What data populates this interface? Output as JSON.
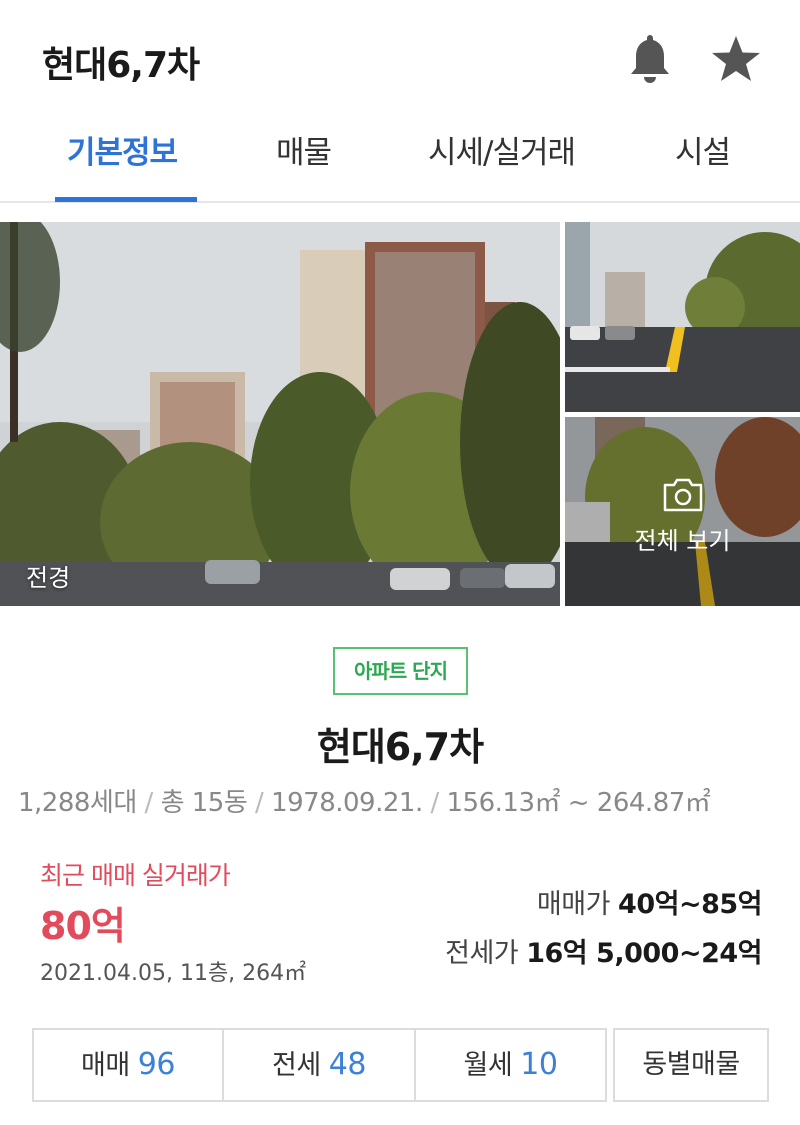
{
  "header": {
    "title": "현대6,7차",
    "icons": [
      "bell-icon",
      "star-icon"
    ]
  },
  "tabs": [
    {
      "label": "기본정보",
      "active": true
    },
    {
      "label": "매물",
      "active": false
    },
    {
      "label": "시세/실거래",
      "active": false
    },
    {
      "label": "시설",
      "active": false
    }
  ],
  "photos": {
    "main_label": "전경",
    "view_all_label": "전체 보기"
  },
  "summary": {
    "badge": "아파트 단지",
    "name": "현대6,7차",
    "households": "1,288세대",
    "buildings": "총 15동",
    "approval_date": "1978.09.21.",
    "area_range": "156.13㎡ ~ 264.87㎡"
  },
  "recent_trade": {
    "label": "최근 매매 실거래가",
    "price": "80억",
    "detail": "2021.04.05, 11층, 264㎡"
  },
  "price_ranges": {
    "sale_label": "매매가",
    "sale_value": "40억~85억",
    "jeonse_label": "전세가",
    "jeonse_value": "16억 5,000~24억"
  },
  "listing_buttons": {
    "sale_label": "매매",
    "sale_count": "96",
    "jeonse_label": "전세",
    "jeonse_count": "48",
    "monthly_label": "월세",
    "monthly_count": "10",
    "by_building_label": "동별매물"
  },
  "colors": {
    "accent_blue": "#2e73d8",
    "price_red": "#e24b5c",
    "badge_green": "#56c272"
  }
}
